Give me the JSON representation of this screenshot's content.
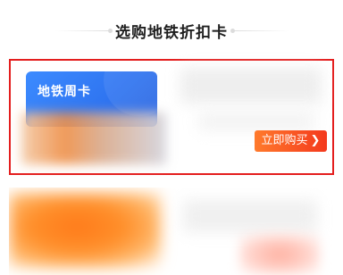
{
  "section": {
    "title": "选购地铁折扣卡"
  },
  "card_1": {
    "image_label": "地铁周卡",
    "buy_label": "立即购买",
    "buy_chevron_icon": "chevron-right-icon",
    "highlight_color": "#e41e1e",
    "button_color": "#f4391d"
  }
}
